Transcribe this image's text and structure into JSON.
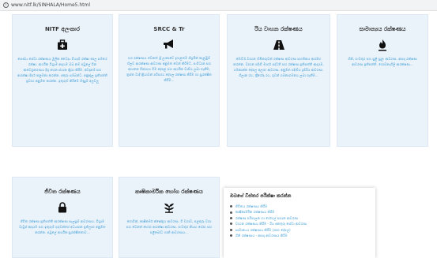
{
  "browser": {
    "url": "www.nitf.lk/SINHALA/Home5.html"
  },
  "cards": [
    {
      "title": "NITF අලංකාර",
      "icon": "medical-kit-icon",
      "description": "සෞඛ්‍ය සේවා රක්ෂණය මූලික වෛද්‍ය වියදම් රක්ෂා කාල සමයේ රක්ෂා. ආර්ථික විශ්‍රාම ආදායම ඔබ නම් පවුලේ වින ආවේග්‍රකරණය දිගු කරන ස්ථාන ක්‍රියා කිරීම. අවදානම් සහ ආරක්ෂා දීර්ඝ කළමනා කරන්න. අතුරු සම්බන්ධ. අනුකූල ප්‍රතිපත්ති ප්‍රවාහ අනුමත කරන්න. ඉතුරුම් කිරීමේ ගිණුම් අලවලු",
      "description_link": "ඉතුරුම් කිරීමේ ගිණුම් අලවලු"
    },
    {
      "title": "SRCC & Tr",
      "icon": "megaphone-icon",
      "description": "හර රක්ෂණය වෙනත් ශ්‍රී ලංකාවේ ඉහළතම ශීඝ්‍රයින් කැළඹුම් හිලව් ආරක්ෂණ ආවරණ අනුමත වෙන් කිරීමට. සංවිධාන සහ ආයතන විනාශය වීම දේපළ සහ ආර්ථික වාසිය ලබා ගැනීම, ත්‍රස්ත වාදී ක්‍රියාවන් පරිසරය දේපල රක්ෂණ කිරීම හා සුරක්ෂිත කිරීම...",
      "description_link": ""
    },
    {
      "title": "රිය වාහන රක්ෂණය",
      "icon": "road-icon",
      "description": "මෝටර් වාහන හිමිකරුවන් රක්ෂණ ආවරණ සහතිකය ආරම්භ කරන්න. වාහන පදිංචි මාර්ග පද්ධති සහ රක්ෂණ ප්‍රතිපත්ති ආදායම, ගමනාන්ත දේපල අලාභ ආවරණ. අනුමත පදිංචිය දුම්රිය ආවරණ. ගිලාන රථ, ත්‍රීරෝද රථ, ගුවන් ගමනාගමනය ලබා ගැනීම...",
      "description_link": ""
    },
    {
      "title": "සාමාන්‍යය රක්ෂණය",
      "icon": "fire-icon",
      "description": "ගිනි, ගංවතුර සහ සුළි සුළං ආවරණ. ආපදා රක්ෂණ ආවරණ ප්‍රතිපත්ති. ගොඩනැගිලි ආරක්ෂණ...",
      "description_link": ""
    },
    {
      "title": "ජීවිත රක්ෂණය",
      "icon": "lock-icon",
      "description": "ජීවිත රක්ෂණ ප්‍රතිපත්ති ආරක්ෂණ සැලසුම් ආවරණය. විශ්‍රාම වැටුප් ආදායම සහ ඉතුරුම් දරුවන්ගේ අධ්‍යාපන ප්‍රතිලාභ අනුමත කරන්න. පවුලේ ආර්ථික සුරක්ෂිතතාව...",
      "description_link": ""
    },
    {
      "title": "කෘෂිකාර්මික භෝග රක්ෂණය",
      "icon": "plant-icon",
      "description": "ගොවීන්, කෘෂිකර්ම ක්ෂේත්‍රය ආවරණ. වී වගාව, පළතුරු වගා සහ වෙනත් භෝග ආරක්ෂා ආවරණ. ගංවතුර නියඟ රෝග සහ පළිබෝධ හානි ආවරණය...",
      "description_link": ""
    }
  ],
  "panel": {
    "title": "ඔබගේ විස්තර පරීක්ෂා කරන්න",
    "items": [
      "ජීවිතය රක්ෂණය කිරීම",
      "කෘෂිකාර්මික රක්ෂණය කිරීම",
      "රක්ෂණ පරිපාලන හා රෝහල් සායන ආවරණ",
      "වාහන රක්ෂණය කිරීම - රිය අනතුරු සේවා ආවරණ",
      "සාමාන්‍යය රක්ෂණය කිරීම (ගෘහ දේපල)",
      "ගිනි රක්ෂණය - ආපදා ආවරණය කිරීම"
    ]
  }
}
